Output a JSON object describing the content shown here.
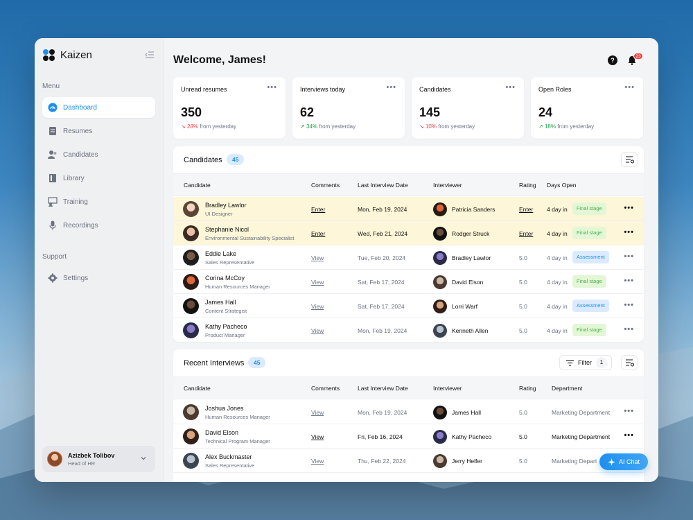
{
  "app": {
    "name": "Kaizen",
    "brand_color": "#1d8ff0"
  },
  "sidebar": {
    "menu_label": "Menu",
    "support_label": "Support",
    "items": [
      {
        "label": "Dashboard",
        "icon": "dashboard-icon",
        "active": true
      },
      {
        "label": "Resumes",
        "icon": "resumes-icon"
      },
      {
        "label": "Candidates",
        "icon": "candidates-icon"
      },
      {
        "label": "Library",
        "icon": "library-icon"
      },
      {
        "label": "Training",
        "icon": "training-icon"
      },
      {
        "label": "Recordings",
        "icon": "microphone-icon"
      }
    ],
    "support_items": [
      {
        "label": "Settings",
        "icon": "gear-icon"
      }
    ],
    "user": {
      "name": "Azizbek Tolibov",
      "role": "Head of HR"
    }
  },
  "header": {
    "welcome": "Welcome, James!",
    "notification_count": "23"
  },
  "stats": [
    {
      "title": "Unread resumes",
      "value": "350",
      "delta": "28%",
      "trend": "down",
      "suffix": "from yesterday"
    },
    {
      "title": "Interviews today",
      "value": "62",
      "delta": "34%",
      "trend": "up",
      "suffix": "from yesterday"
    },
    {
      "title": "Candidates",
      "value": "145",
      "delta": "10%",
      "trend": "down",
      "suffix": "from yesterday"
    },
    {
      "title": "Open Roles",
      "value": "24",
      "delta": "18%",
      "trend": "up",
      "suffix": "from yesterday"
    }
  ],
  "candidates": {
    "title": "Candidates",
    "count": "45",
    "columns": [
      "Candidate",
      "Comments",
      "Last Interview Date",
      "Interviewer",
      "Rating",
      "Days Open"
    ],
    "rows": [
      {
        "name": "Bradley Lawlor",
        "role": "UI Designer",
        "comment": "Enter",
        "date": "Mon, Feb 19, 2024",
        "interviewer": "Patricia Sanders",
        "rating": "Enter",
        "days": "4 day in",
        "stage": "Final stage",
        "stage_type": "final",
        "highlight": true
      },
      {
        "name": "Stephanie Nicol",
        "role": "Environmental Sustainability Specialist",
        "comment": "Enter",
        "date": "Wed, Feb 21, 2024",
        "interviewer": "Rodger Struck",
        "rating": "Enter",
        "days": "4 day in",
        "stage": "Final stage",
        "stage_type": "final",
        "highlight": true
      },
      {
        "name": "Eddie Lake",
        "role": "Sales Representative",
        "comment": "View",
        "date": "Tue, Feb 20, 2024",
        "interviewer": "Bradley Lawlor",
        "rating": "5.0",
        "days": "4 day in",
        "stage": "Assessment",
        "stage_type": "assess"
      },
      {
        "name": "Corina McCoy",
        "role": "Human Resources Manager",
        "comment": "View",
        "date": "Sat, Feb 17, 2024",
        "interviewer": "David Elson",
        "rating": "5.0",
        "days": "4 day in",
        "stage": "Final stage",
        "stage_type": "final"
      },
      {
        "name": "James Hall",
        "role": "Content Strategist",
        "comment": "View",
        "date": "Sat, Feb 17, 2024",
        "interviewer": "Lorri Warf",
        "rating": "5.0",
        "days": "4 day in",
        "stage": "Assessment",
        "stage_type": "assess"
      },
      {
        "name": "Kathy Pacheco",
        "role": "Product Manager",
        "comment": "View",
        "date": "Mon, Feb 19, 2024",
        "interviewer": "Kenneth Allen",
        "rating": "5.0",
        "days": "4 day in",
        "stage": "Final stage",
        "stage_type": "final"
      }
    ]
  },
  "interviews": {
    "title": "Recent Interviews",
    "count": "45",
    "filter_label": "Filter",
    "filter_count": "1",
    "columns": [
      "Candidate",
      "Comments",
      "Last Interview Date",
      "Interviewer",
      "Rating",
      "Department"
    ],
    "rows": [
      {
        "name": "Joshua Jones",
        "role": "Human Resources Manager",
        "comment": "View",
        "date": "Mon, Feb 19, 2024",
        "interviewer": "James Hall",
        "rating": "5.0",
        "department": "Marketing Department"
      },
      {
        "name": "David Elson",
        "role": "Technical Program Manager",
        "comment": "View",
        "date": "Fri, Feb 16, 2024",
        "interviewer": "Kathy Pacheco",
        "rating": "5.0",
        "department": "Marketing Department",
        "emphasis": true
      },
      {
        "name": "Alex Buckmaster",
        "role": "Sales Representative",
        "comment": "View",
        "date": "Thu, Feb 22, 2024",
        "interviewer": "Jerry Helfer",
        "rating": "5.0",
        "department": "Marketing Depart"
      }
    ]
  },
  "ai_chat": {
    "label": "AI Chat"
  }
}
